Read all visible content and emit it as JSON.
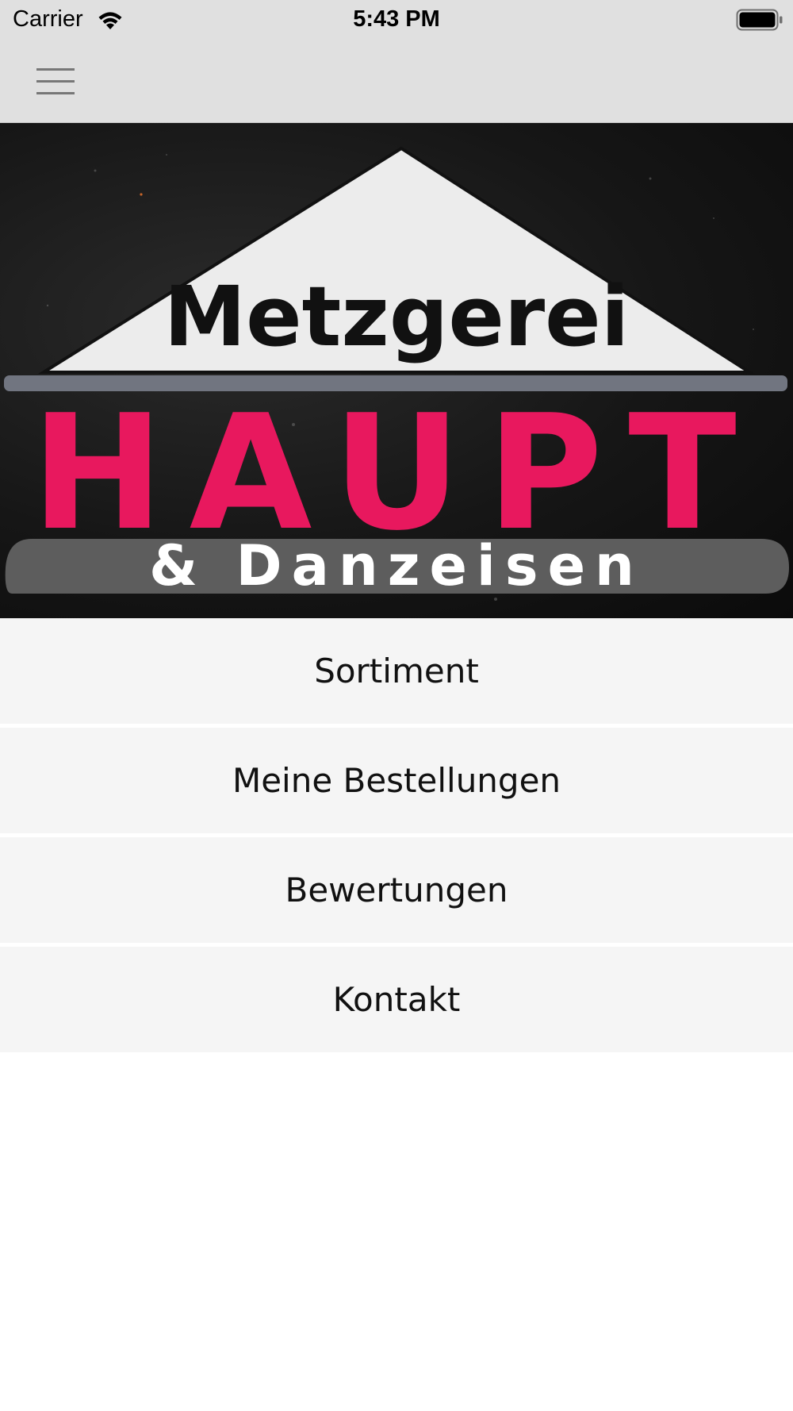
{
  "status_bar": {
    "carrier": "Carrier",
    "time": "5:43 PM"
  },
  "nav": {
    "menu_icon": "hamburger-menu-icon"
  },
  "logo": {
    "line1": "Metzgerei",
    "line2": "HAUPT",
    "line3": "& Danzeisen",
    "accent_color": "#e8185e"
  },
  "menu": {
    "items": [
      {
        "label": "Sortiment"
      },
      {
        "label": "Meine Bestellungen"
      },
      {
        "label": "Bewertungen"
      },
      {
        "label": "Kontakt"
      }
    ]
  }
}
